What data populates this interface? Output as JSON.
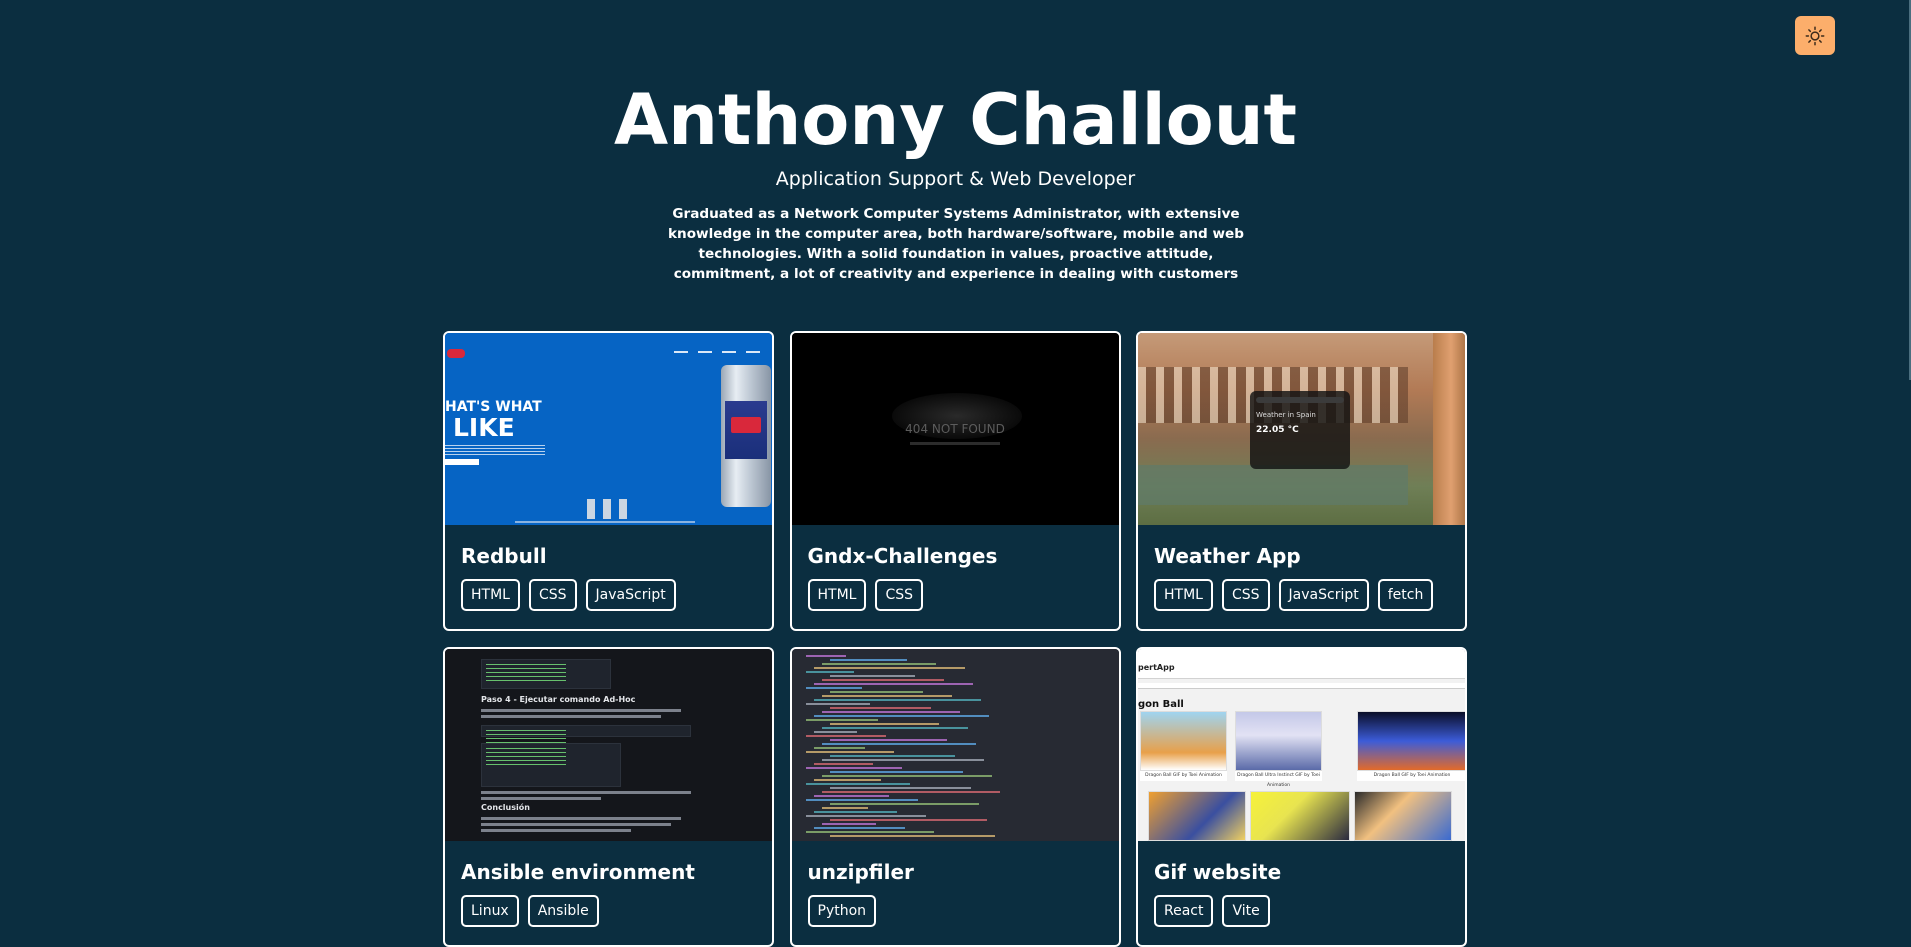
{
  "header": {
    "name": "Anthony Challout",
    "role": "Application Support & Web Developer",
    "bio": "Graduated as a Network Computer Systems Administrator, with extensive knowledge in the computer area, both hardware/software, mobile and web technologies. With a solid foundation in values, proactive attitude, commitment, a lot of creativity and experience in dealing with customers"
  },
  "theme_toggle": {
    "icon": "sun-icon",
    "color": "#fcae6b"
  },
  "colors": {
    "background": "#0b2e40",
    "text": "#ffffff",
    "accent": "#fcae6b"
  },
  "projects": [
    {
      "title": "Redbull",
      "thumbnail": "redbull-landing-screenshot",
      "tags": [
        "HTML",
        "CSS",
        "JavaScript"
      ]
    },
    {
      "title": "Gndx-Challenges",
      "thumbnail": "404-not-found-screenshot",
      "thumb_text": "404 NOT FOUND",
      "tags": [
        "HTML",
        "CSS"
      ]
    },
    {
      "title": "Weather App",
      "thumbnail": "weather-app-screenshot",
      "thumb_text": "Weather in Spain",
      "thumb_temp": "22.05 °C",
      "tags": [
        "HTML",
        "CSS",
        "JavaScript",
        "fetch"
      ]
    },
    {
      "title": "Ansible environment",
      "thumbnail": "ansible-docs-screenshot",
      "thumb_heading_1": "Paso 4 - Ejecutar comando Ad-Hoc",
      "thumb_heading_2": "Conclusión",
      "tags": [
        "Linux",
        "Ansible"
      ]
    },
    {
      "title": "unzipfiler",
      "thumbnail": "python-code-screenshot",
      "tags": [
        "Python"
      ]
    },
    {
      "title": "Gif website",
      "thumbnail": "gif-app-screenshot",
      "thumb_brand": "pertApp",
      "thumb_section": "gon Ball",
      "thumb_caps": [
        "Dragon Ball GIF by Toei Animation",
        "Dragon Ball Ultra Instinct GIF by Toei Animation",
        "Dragon Ball GIF by Toei Animation"
      ],
      "tags": [
        "React",
        "Vite"
      ]
    }
  ]
}
